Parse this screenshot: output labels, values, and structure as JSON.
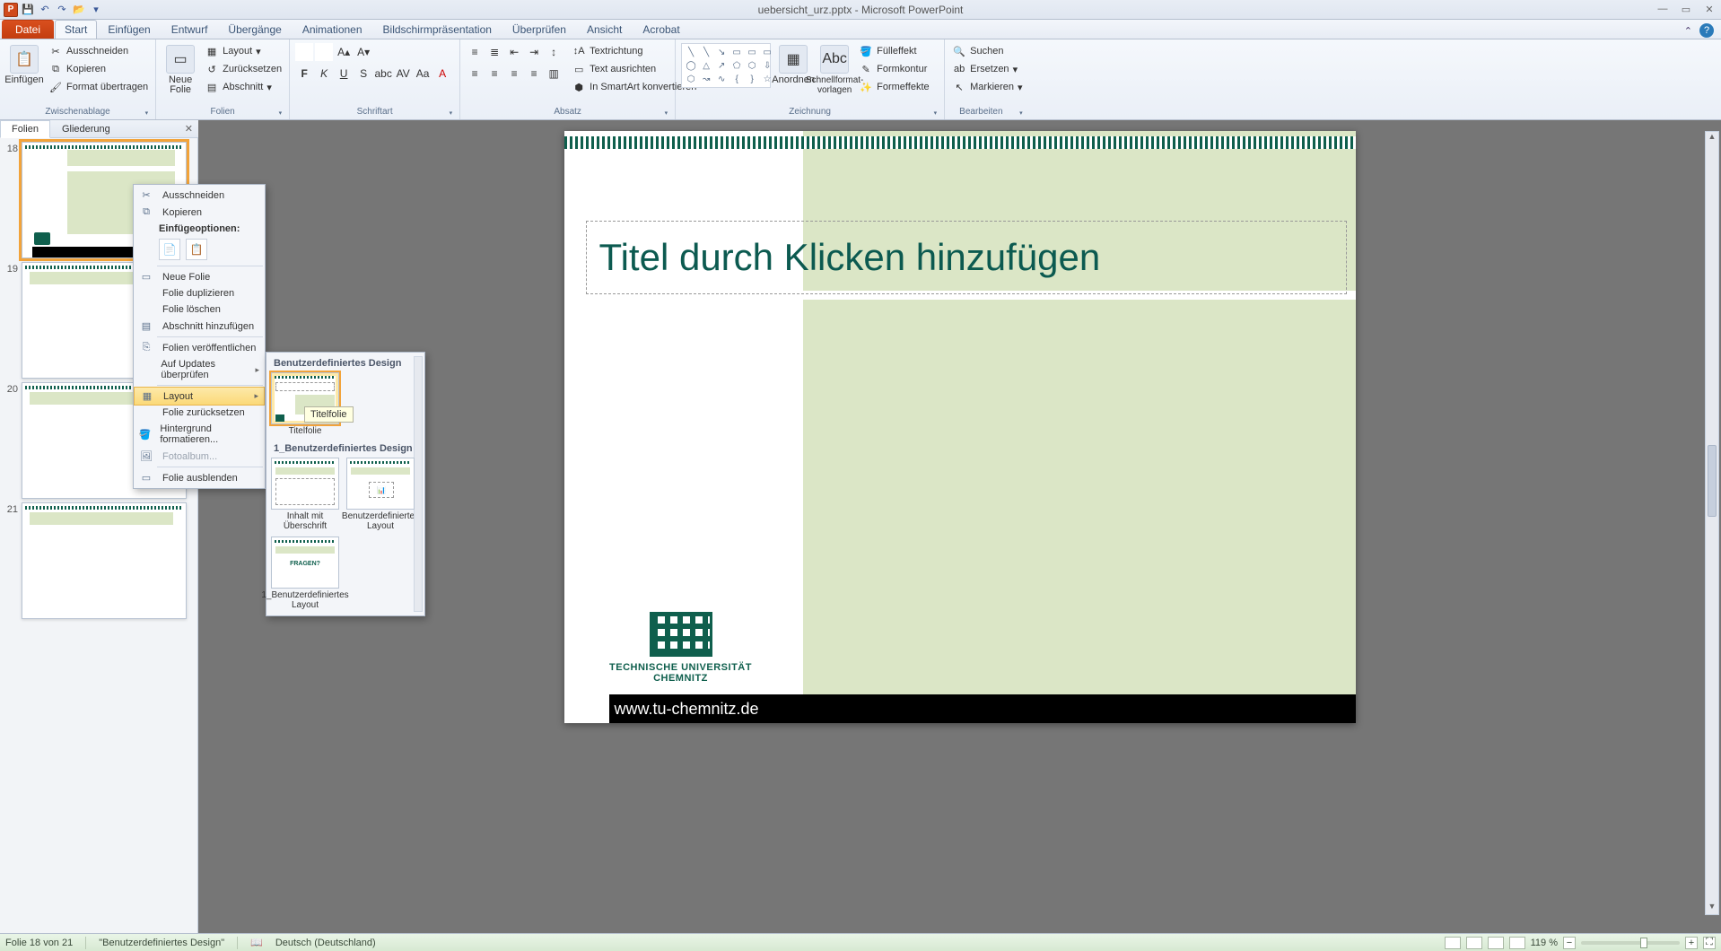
{
  "window": {
    "title": "uebersicht_urz.pptx - Microsoft PowerPoint"
  },
  "tabs": {
    "file": "Datei",
    "items": [
      "Start",
      "Einfügen",
      "Entwurf",
      "Übergänge",
      "Animationen",
      "Bildschirmpräsentation",
      "Überprüfen",
      "Ansicht",
      "Acrobat"
    ],
    "active": "Start"
  },
  "ribbon": {
    "clipboard": {
      "label": "Zwischenablage",
      "paste": "Einfügen",
      "cut": "Ausschneiden",
      "copy": "Kopieren",
      "format_painter": "Format übertragen"
    },
    "slides": {
      "label": "Folien",
      "new_slide": "Neue Folie",
      "layout": "Layout",
      "reset": "Zurücksetzen",
      "section": "Abschnitt"
    },
    "font": {
      "label": "Schriftart"
    },
    "paragraph": {
      "label": "Absatz",
      "text_direction": "Textrichtung",
      "align_text": "Text ausrichten",
      "convert_smartart": "In SmartArt konvertieren"
    },
    "drawing": {
      "label": "Zeichnung",
      "arrange": "Anordnen",
      "quick_styles": "Schnellformat-vorlagen",
      "shape_fill": "Fülleffekt",
      "shape_outline": "Formkontur",
      "shape_effects": "Formeffekte"
    },
    "editing": {
      "label": "Bearbeiten",
      "find": "Suchen",
      "replace": "Ersetzen",
      "select": "Markieren"
    }
  },
  "pane_tabs": {
    "slides": "Folien",
    "outline": "Gliederung"
  },
  "thumbs": [
    {
      "num": "18"
    },
    {
      "num": "19"
    },
    {
      "num": "20"
    },
    {
      "num": "21"
    }
  ],
  "context_menu": {
    "cut": "Ausschneiden",
    "copy": "Kopieren",
    "paste_options": "Einfügeoptionen:",
    "new_slide": "Neue Folie",
    "duplicate": "Folie duplizieren",
    "delete": "Folie löschen",
    "add_section": "Abschnitt hinzufügen",
    "publish": "Folien veröffentlichen",
    "check_updates": "Auf Updates überprüfen",
    "layout": "Layout",
    "reset": "Folie zurücksetzen",
    "format_bg": "Hintergrund formatieren...",
    "photo_album": "Fotoalbum...",
    "hide": "Folie ausblenden"
  },
  "layout_flyout": {
    "section1": "Benutzerdefiniertes Design",
    "item1": "Titelfolie",
    "tooltip": "Titelfolie",
    "section2": "1_Benutzerdefiniertes Design",
    "item2": "Inhalt mit Überschrift",
    "item3": "Benutzerdefiniertes Layout",
    "item4": "1_Benutzerdefiniertes Layout"
  },
  "slide": {
    "title_placeholder": "Titel durch Klicken hinzufügen",
    "footer_url": "www.tu-chemnitz.de",
    "org_line1": "TECHNISCHE UNIVERSITÄT",
    "org_line2": "CHEMNITZ"
  },
  "status": {
    "slide_of": "Folie 18 von 21",
    "design": "\"Benutzerdefiniertes Design\"",
    "language": "Deutsch (Deutschland)",
    "zoom": "119 %"
  }
}
